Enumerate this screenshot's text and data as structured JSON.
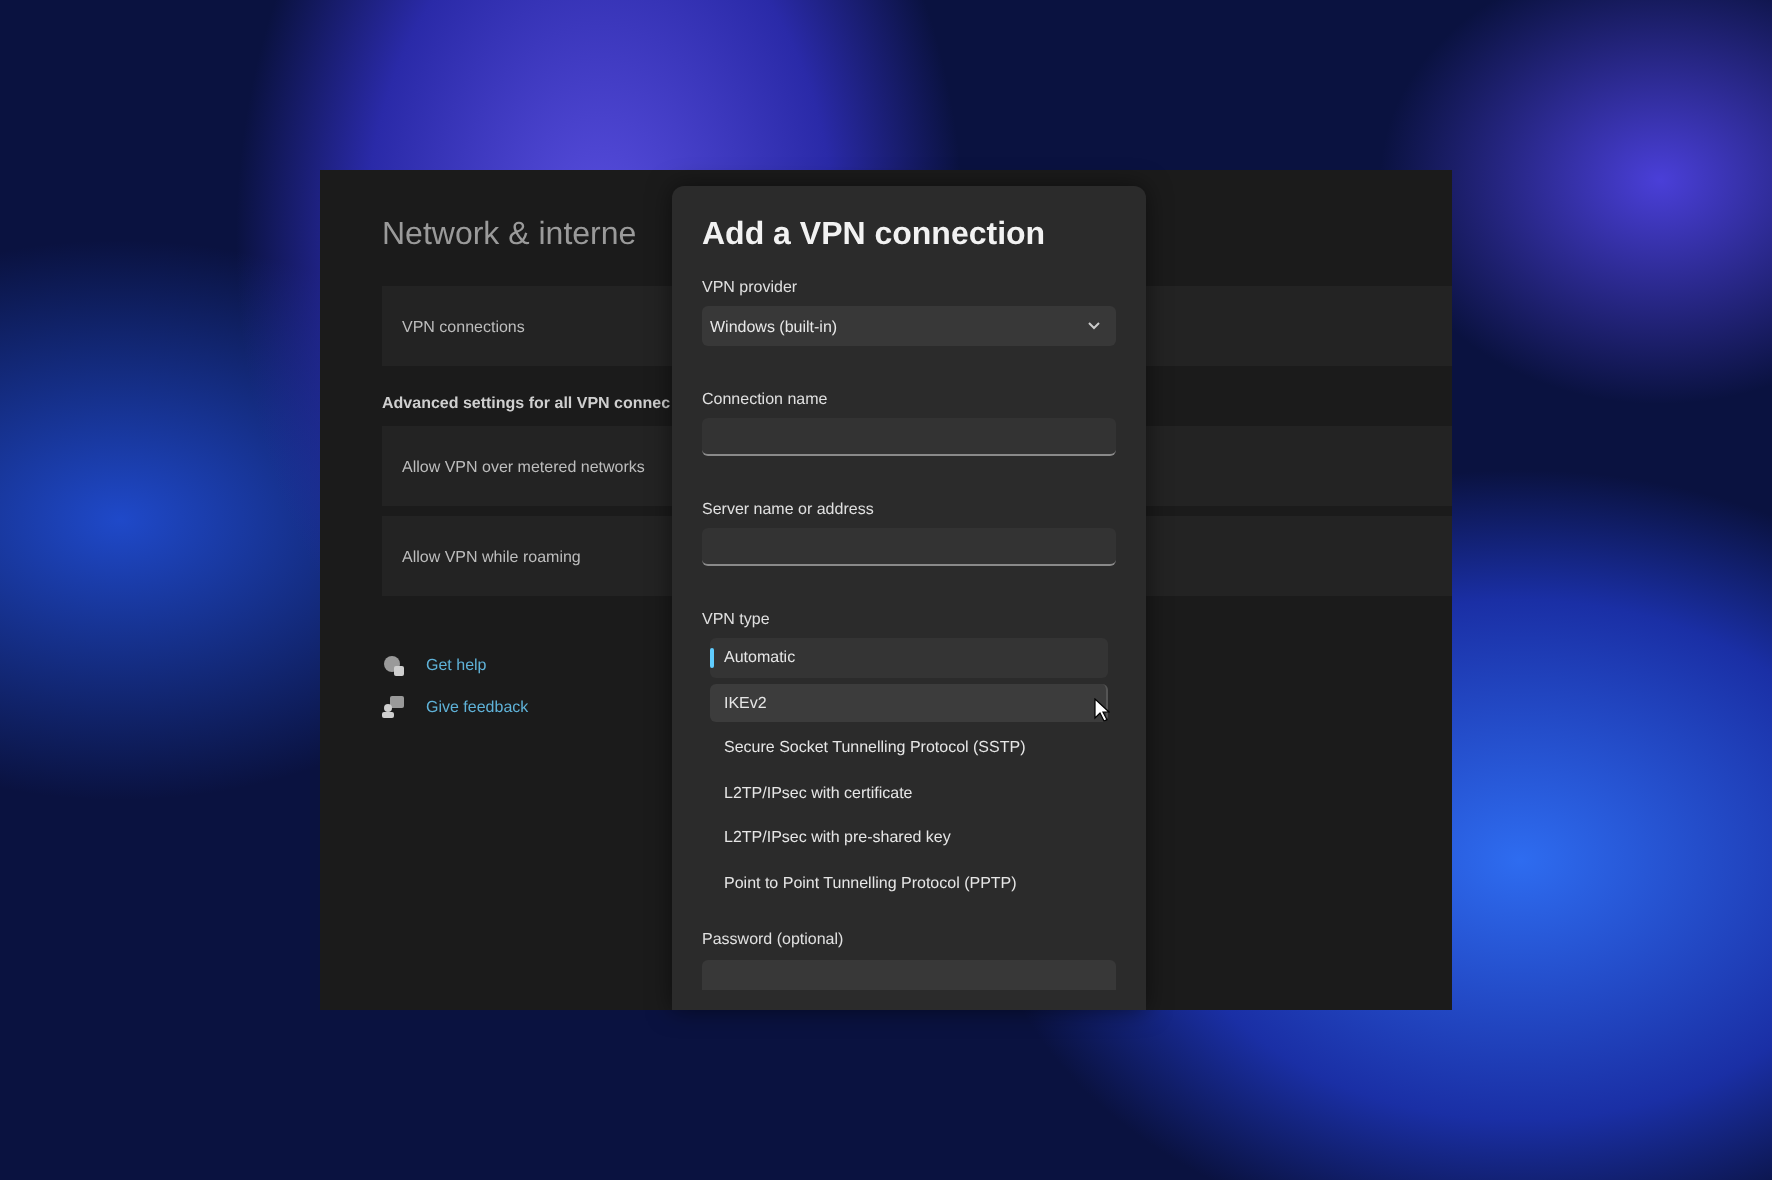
{
  "settings": {
    "title": "Network & interne",
    "rows": [
      {
        "label": "VPN connections"
      }
    ],
    "section_heading": "Advanced settings for all VPN connec",
    "advanced_rows": [
      {
        "label": "Allow VPN over metered networks"
      },
      {
        "label": "Allow VPN while roaming"
      }
    ],
    "links": [
      {
        "kind": "help",
        "label": "Get help"
      },
      {
        "kind": "feedback",
        "label": "Give feedback"
      }
    ]
  },
  "dialog": {
    "title": "Add a VPN connection",
    "fields": [
      {
        "kind": "dropdown",
        "label": "VPN provider",
        "value": "Windows (built-in)"
      },
      {
        "kind": "text",
        "label": "Connection name"
      },
      {
        "kind": "text",
        "label": "Server name or address"
      },
      {
        "kind": "list",
        "label": "VPN type",
        "options": [
          {
            "label": "Automatic",
            "selected": true,
            "hovered": false
          },
          {
            "label": "IKEv2",
            "selected": false,
            "hovered": true
          },
          {
            "label": "Secure Socket Tunnelling Protocol (SSTP)",
            "selected": false,
            "hovered": false
          },
          {
            "label": "L2TP/IPsec with certificate",
            "selected": false,
            "hovered": false
          },
          {
            "label": "L2TP/IPsec with pre-shared key",
            "selected": false,
            "hovered": false
          },
          {
            "label": "Point to Point Tunnelling Protocol (PPTP)",
            "selected": false,
            "hovered": false
          }
        ]
      },
      {
        "kind": "password",
        "label": "Password (optional)"
      }
    ]
  }
}
